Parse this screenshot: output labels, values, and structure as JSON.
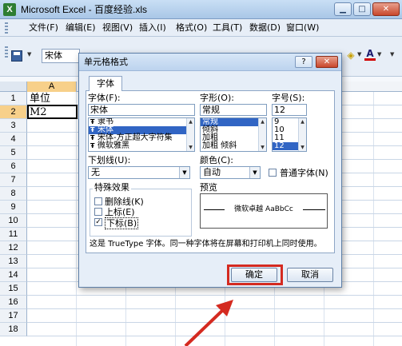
{
  "window": {
    "title": "Microsoft Excel - 百度经验.xls",
    "app_icon": "excel-icon"
  },
  "menu": {
    "items": [
      "文件(F)",
      "编辑(E)",
      "视图(V)",
      "插入(I)",
      "格式(O)",
      "工具(T)",
      "数据(D)",
      "窗口(W)"
    ]
  },
  "toolbar": {
    "font_name": "宋体"
  },
  "sheet": {
    "column_header": "A",
    "rows": [
      "1",
      "2",
      "3",
      "4",
      "5",
      "6",
      "7",
      "8",
      "9",
      "10",
      "11",
      "12",
      "13",
      "14",
      "15",
      "16",
      "17",
      "18"
    ],
    "cells": {
      "a1": "单位",
      "a2": "M2"
    }
  },
  "dialog": {
    "title": "单元格格式",
    "tab": "字体",
    "font": {
      "label": "字体(F):",
      "value": "宋体",
      "options": [
        "隶书",
        "宋体",
        "宋体-方正超大字符集",
        "微软雅黑"
      ],
      "selected_index": 1
    },
    "style": {
      "label": "字形(O):",
      "value": "常规",
      "options": [
        "常规",
        "倾斜",
        "加粗",
        "加粗 倾斜"
      ],
      "selected_index": 0
    },
    "size": {
      "label": "字号(S):",
      "value": "12",
      "options": [
        "9",
        "10",
        "11",
        "12"
      ],
      "selected_index": 3
    },
    "underline": {
      "label": "下划线(U):",
      "value": "无"
    },
    "color": {
      "label": "颜色(C):",
      "value": "自动"
    },
    "normal_font": {
      "label": "普通字体(N)",
      "checked": false
    },
    "effects": {
      "title": "特殊效果",
      "strikethrough": {
        "label": "删除线(K)",
        "checked": false
      },
      "superscript": {
        "label": "上标(E)",
        "checked": false
      },
      "subscript": {
        "label": "下标(B)",
        "checked": true
      }
    },
    "preview": {
      "title": "预览",
      "sample": "微软卓越 AaBbCc"
    },
    "note": "这是 TrueType 字体。同一种字体将在屏幕和打印机上同时使用。",
    "ok": "确定",
    "cancel": "取消",
    "accent_colors": {
      "selection": "#3165c4",
      "highlight": "#d42a20"
    }
  }
}
